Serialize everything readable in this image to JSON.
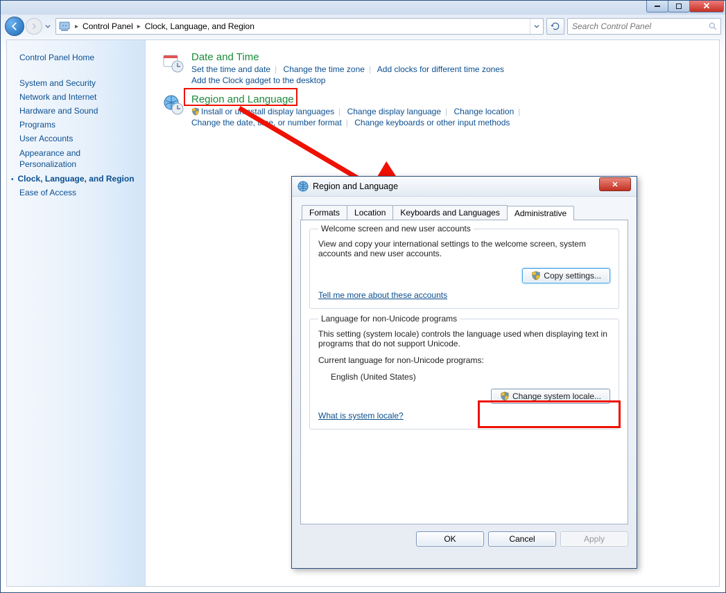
{
  "toolbar": {
    "breadcrumb": {
      "root": "Control Panel",
      "child": "Clock, Language, and Region"
    },
    "search_placeholder": "Search Control Panel"
  },
  "nav": {
    "home": "Control Panel Home",
    "items": [
      "System and Security",
      "Network and Internet",
      "Hardware and Sound",
      "Programs",
      "User Accounts",
      "Appearance and Personalization",
      "Clock, Language, and Region",
      "Ease of Access"
    ]
  },
  "sections": [
    {
      "title": "Date and Time",
      "links_line1": [
        "Set the time and date",
        "Change the time zone",
        "Add clocks for different time zones"
      ],
      "links_line2": [
        "Add the Clock gadget to the desktop"
      ]
    },
    {
      "title": "Region and Language",
      "links_line1": [
        "Install or uninstall display languages",
        "Change display language",
        "Change location"
      ],
      "links_line2": [
        "Change the date, time, or number format",
        "Change keyboards or other input methods"
      ]
    }
  ],
  "dialog": {
    "title": "Region and Language",
    "tabs": [
      "Formats",
      "Location",
      "Keyboards and Languages",
      "Administrative"
    ],
    "group1": {
      "legend": "Welcome screen and new user accounts",
      "desc": "View and copy your international settings to the welcome screen, system accounts and new user accounts.",
      "button": "Copy settings...",
      "link": "Tell me more about these accounts"
    },
    "group2": {
      "legend": "Language for non-Unicode programs",
      "desc": "This setting (system locale) controls the language used when displaying text in programs that do not support Unicode.",
      "current_label": "Current language for non-Unicode programs:",
      "current_value": "English (United States)",
      "button": "Change system locale...",
      "link": "What is system locale?"
    },
    "footer": {
      "ok": "OK",
      "cancel": "Cancel",
      "apply": "Apply"
    }
  }
}
